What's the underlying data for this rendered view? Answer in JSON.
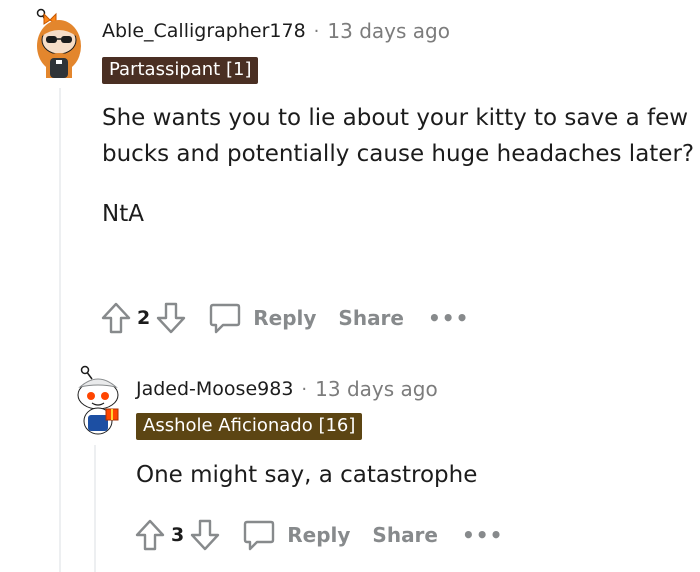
{
  "comments": [
    {
      "username": "Able_Calligrapher178",
      "separator": "·",
      "timestamp": "13 days ago",
      "flair": "Partassipant [1]",
      "flair_color": "#4a2f23",
      "body": [
        "She wants you to lie about your kitty to save a few bucks and potentially cause huge headaches later?",
        "NtA"
      ],
      "vote_count": "2",
      "reply_label": "Reply",
      "share_label": "Share",
      "more_label": "•••"
    },
    {
      "username": "Jaded-Moose983",
      "separator": "·",
      "timestamp": "13 days ago",
      "flair": "Asshole Aficionado [16]",
      "flair_color": "#5c4513",
      "body": [
        "One might say, a catastrophe"
      ],
      "vote_count": "3",
      "reply_label": "Reply",
      "share_label": "Share",
      "more_label": "•••"
    }
  ],
  "icons": {
    "upvote": "upvote-arrow-icon",
    "downvote": "downvote-arrow-icon",
    "reply": "speech-bubble-icon"
  },
  "colors": {
    "text": "#1c1c1c",
    "meta": "#7c7c7c",
    "action": "#878a8c",
    "thread_line": "#edeff1"
  }
}
